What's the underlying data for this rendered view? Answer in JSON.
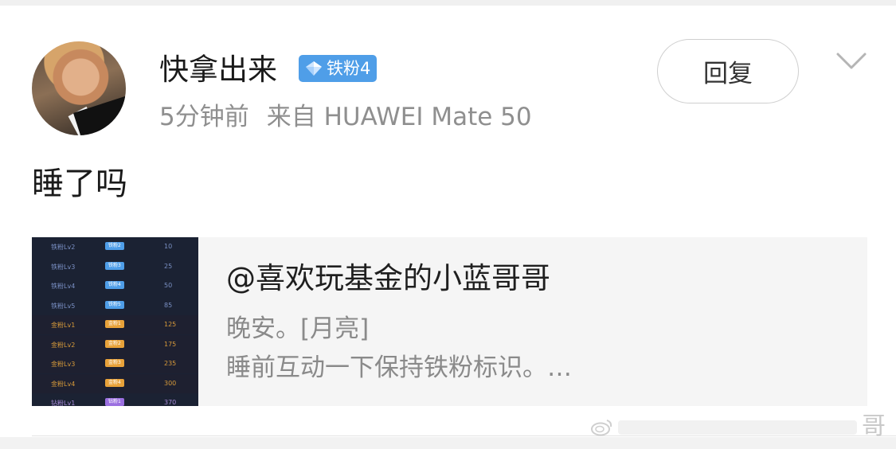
{
  "comment": {
    "username": "快拿出来",
    "badge": "铁粉4",
    "time": "5分钟前",
    "source": "来自 HUAWEI Mate 50",
    "reply_label": "回复",
    "text": "睡了吗"
  },
  "quote": {
    "author": "@喜欢玩基金的小蓝哥哥",
    "line1": "晚安。[月亮]",
    "line2": "睡前互动一下保持铁粉标识。…",
    "thumbnail_rows": [
      {
        "label": "铁粉Lv2",
        "badge": "铁粉2",
        "value": "10"
      },
      {
        "label": "铁粉Lv3",
        "badge": "铁粉3",
        "value": "25"
      },
      {
        "label": "铁粉Lv4",
        "badge": "铁粉4",
        "value": "50"
      },
      {
        "label": "铁粉Lv5",
        "badge": "铁粉5",
        "value": "85"
      },
      {
        "label": "金粉Lv1",
        "badge": "金粉1",
        "value": "125"
      },
      {
        "label": "金粉Lv2",
        "badge": "金粉2",
        "value": "175"
      },
      {
        "label": "金粉Lv3",
        "badge": "金粉3",
        "value": "235"
      },
      {
        "label": "金粉Lv4",
        "badge": "金粉4",
        "value": "300"
      },
      {
        "label": "钻粉Lv1",
        "badge": "钻粉1",
        "value": "370"
      }
    ]
  },
  "watermark": {
    "char": "哥"
  },
  "colors": {
    "badge_blue": "#4f9ee8",
    "badge_gold": "#e8a23a",
    "badge_purple": "#9b6fe0",
    "meta_gray": "#8f8f8f",
    "card_bg": "#f5f5f5"
  }
}
